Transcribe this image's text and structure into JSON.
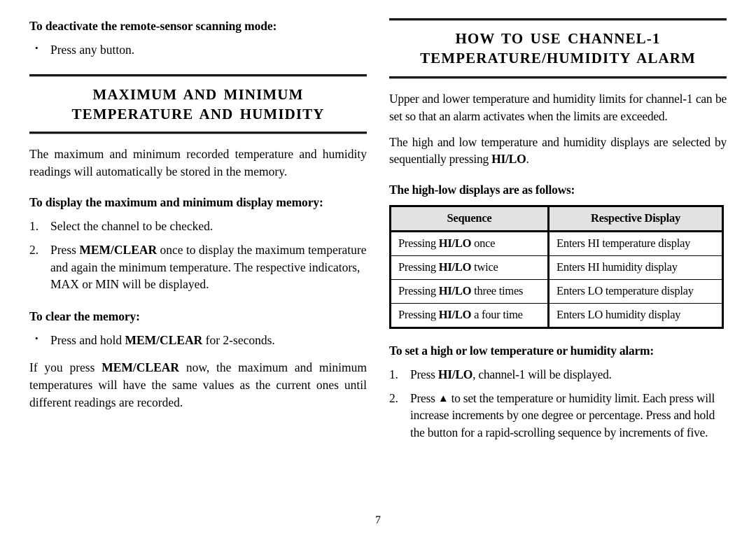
{
  "page": {
    "number": "7"
  },
  "left_column": {
    "deactivate": {
      "heading": "To deactivate the remote-sensor scanning mode:",
      "bullets": [
        {
          "marker": "•",
          "text": "Press any button."
        }
      ]
    },
    "section": {
      "title_line1": "MAXIMUM AND MINIMUM",
      "title_line2": "TEMPERATURE AND HUMIDITY",
      "intro": "The maximum and minimum recorded temperature and humidity readings will automatically be stored in the memory."
    },
    "display_memory": {
      "heading": "To display the maximum and minimum display memory:",
      "steps": [
        {
          "marker": "1.",
          "text": "Select the channel to be checked."
        },
        {
          "marker": "2.",
          "pre": "Press ",
          "bold": "MEM/CLEAR",
          "post": " once to display the maximum temperature and again the minimum temperature. The respective indicators, MAX or MIN will be displayed."
        }
      ]
    },
    "clear_memory": {
      "heading": "To clear the memory:",
      "bullets": [
        {
          "marker": "•",
          "pre": "Press and hold ",
          "bold": "MEM/CLEAR",
          "post": " for 2-seconds."
        }
      ],
      "note_pre": "If you press ",
      "note_bold": "MEM/CLEAR",
      "note_post": " now, the maximum and minimum temperatures will have the same values as the current ones until different readings are recorded."
    }
  },
  "right_column": {
    "section": {
      "title_line1": "HOW TO USE CHANNEL-1",
      "title_line2": "TEMPERATURE/HUMIDITY ALARM"
    },
    "intro_paragraph": "Upper and lower temperature and humidity limits for channel-1 can be set so that an alarm activates when the limits are exceeded.",
    "select_paragraph": {
      "pre": "The high and low temperature and humidity displays are selected by sequentially pressing ",
      "bold": "HI/LO",
      "post": "."
    },
    "table": {
      "caption": "The high-low displays are as follows:",
      "columns": [
        "Sequence",
        "Respective Display"
      ],
      "rows": [
        {
          "sequence_pre": "Pressing ",
          "sequence_bold": "HI/LO",
          "sequence_post": " once",
          "display": "Enters HI temperature display"
        },
        {
          "sequence_pre": "Pressing ",
          "sequence_bold": "HI/LO",
          "sequence_post": " twice",
          "display": "Enters HI humidity display"
        },
        {
          "sequence_pre": "Pressing ",
          "sequence_bold": "HI/LO",
          "sequence_post": " three times",
          "display": "Enters LO temperature display"
        },
        {
          "sequence_pre": "Pressing ",
          "sequence_bold": "HI/LO",
          "sequence_post": " a four time",
          "display": "Enters LO humidity display"
        }
      ]
    },
    "alarm_setting": {
      "heading": "To set a high or low temperature or humidity alarm:",
      "steps": [
        {
          "marker": "1.",
          "pre": "Press ",
          "bold": "HI/LO",
          "post": ", channel-1 will be displayed."
        },
        {
          "marker": "2.",
          "pre": "Press ",
          "symbol": "▲",
          "post": " to set the temperature or humidity limit. Each press will increase increments by one degree or percentage. Press and hold the button for a rapid-scrolling sequence by increments of five."
        }
      ]
    }
  },
  "colors": {
    "text": "#000000",
    "rule": "#1a1a1a",
    "table_header_fill": "#e2e2e2",
    "table_border": "#000000"
  }
}
